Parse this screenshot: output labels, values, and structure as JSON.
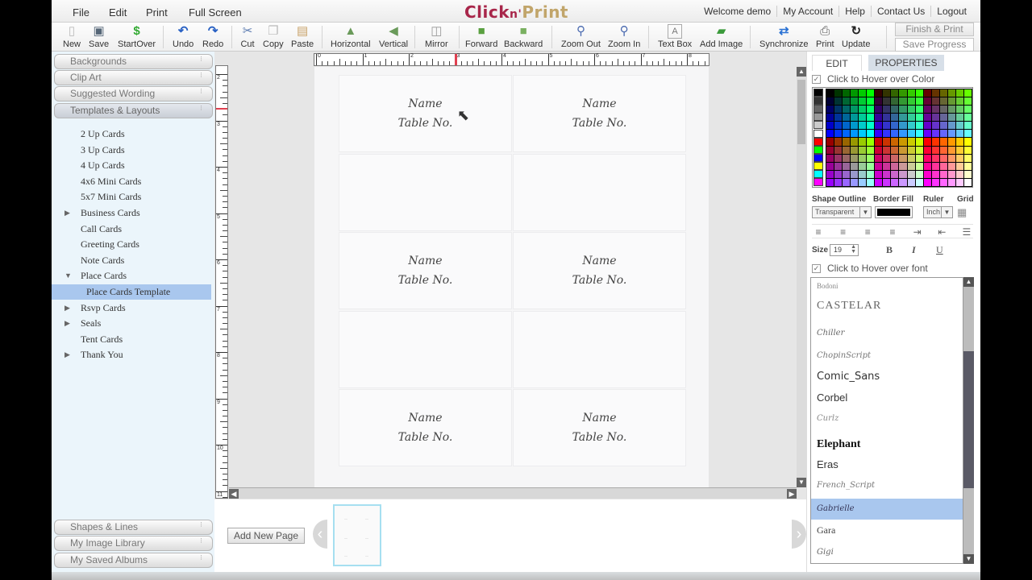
{
  "menubar": {
    "items": [
      "File",
      "Edit",
      "Print",
      "Full Screen"
    ],
    "logo": {
      "part1": "Click",
      "part2": "n'",
      "part3": "Print"
    },
    "user_links": [
      "Welcome demo",
      "My Account",
      "Help",
      "Contact Us",
      "Logout"
    ]
  },
  "toolbar": {
    "buttons": [
      {
        "label": "New",
        "icon": "new-document-icon"
      },
      {
        "label": "Save",
        "icon": "save-icon"
      },
      {
        "label": "StartOver",
        "icon": "start-over-icon"
      },
      {
        "label": "Undo",
        "icon": "undo-icon"
      },
      {
        "label": "Redo",
        "icon": "redo-icon"
      },
      {
        "label": "Cut",
        "icon": "scissors-icon"
      },
      {
        "label": "Copy",
        "icon": "copy-icon"
      },
      {
        "label": "Paste",
        "icon": "paste-icon"
      },
      {
        "label": "Horizontal",
        "icon": "flip-horizontal-icon"
      },
      {
        "label": "Vertical",
        "icon": "flip-vertical-icon"
      },
      {
        "label": "Mirror",
        "icon": "mirror-icon"
      },
      {
        "label": "Forward",
        "icon": "bring-forward-icon"
      },
      {
        "label": "Backward",
        "icon": "send-backward-icon"
      },
      {
        "label": "Zoom Out",
        "icon": "zoom-out-icon"
      },
      {
        "label": "Zoom In",
        "icon": "zoom-in-icon"
      },
      {
        "label": "Text Box",
        "icon": "text-box-icon"
      },
      {
        "label": "Add Image",
        "icon": "add-image-icon"
      },
      {
        "label": "Synchronize",
        "icon": "synchronize-icon"
      },
      {
        "label": "Print",
        "icon": "printer-icon"
      },
      {
        "label": "Update",
        "icon": "refresh-icon"
      }
    ],
    "finish_print": "Finish & Print",
    "save_progress": "Save Progress"
  },
  "left_panel": {
    "accordion_top": [
      "Backgrounds",
      "Clip Art",
      "Suggested Wording",
      "Templates & Layouts"
    ],
    "tree": [
      {
        "label": "2 Up Cards",
        "arrow": ""
      },
      {
        "label": "3 Up Cards",
        "arrow": ""
      },
      {
        "label": "4 Up Cards",
        "arrow": ""
      },
      {
        "label": "4x6 Mini Cards",
        "arrow": ""
      },
      {
        "label": "5x7 Mini Cards",
        "arrow": ""
      },
      {
        "label": "Business Cards",
        "arrow": "▶"
      },
      {
        "label": "Call Cards",
        "arrow": ""
      },
      {
        "label": "Greeting Cards",
        "arrow": ""
      },
      {
        "label": "Note Cards",
        "arrow": ""
      },
      {
        "label": "Place Cards",
        "arrow": "▼"
      },
      {
        "label": "Place Cards Template",
        "arrow": "",
        "selected": true,
        "child": true
      },
      {
        "label": "Rsvp Cards",
        "arrow": "▶"
      },
      {
        "label": "Seals",
        "arrow": "▶"
      },
      {
        "label": "Tent Cards",
        "arrow": ""
      },
      {
        "label": "Thank You",
        "arrow": "▶"
      }
    ],
    "accordion_bottom": [
      "Shapes & Lines",
      "My Image Library",
      "My Saved Albums"
    ]
  },
  "canvas": {
    "ruler_h_labels": [
      "0",
      "1",
      "2",
      "3",
      "4",
      "5",
      "6",
      "7",
      "8"
    ],
    "ruler_v_labels": [
      "2",
      "3",
      "4",
      "5",
      "6",
      "7",
      "8",
      "9",
      "10",
      "11"
    ],
    "cards": [
      {
        "name": "Name",
        "table": "Table No."
      },
      {
        "name": "Name",
        "table": "Table No."
      },
      {
        "name": "",
        "table": ""
      },
      {
        "name": "",
        "table": ""
      },
      {
        "name": "Name",
        "table": "Table No."
      },
      {
        "name": "Name",
        "table": "Table No."
      },
      {
        "name": "",
        "table": ""
      },
      {
        "name": "",
        "table": ""
      },
      {
        "name": "Name",
        "table": "Table No."
      },
      {
        "name": "Name",
        "table": "Table No."
      }
    ]
  },
  "page_strip": {
    "add_new_page": "Add New Page"
  },
  "right_panel": {
    "tabs": [
      "EDIT",
      "PROPERTIES"
    ],
    "active_tab": "EDIT",
    "hover_color_label": "Click to Hover over Color",
    "hover_color_checked": true,
    "labels": {
      "shape_outline": "Shape Outline",
      "border_fill": "Border Fill",
      "ruler": "Ruler",
      "grid": "Grid"
    },
    "shape_outline_value": "Transparent",
    "border_fill_color": "#000000",
    "ruler_value": "Inch",
    "size_label": "Size",
    "size_value": "19",
    "bold": "B",
    "italic": "I",
    "underline": "U",
    "hover_font_label": "Click to Hover over font",
    "hover_font_checked": true,
    "fonts": [
      "Bodoni",
      "CASTELAR",
      "Chiller",
      "ChopinScript",
      "Comic_Sans",
      "Corbel",
      "Curlz",
      "Elephant",
      "Eras",
      "French_Script",
      "Gabrielle",
      "Gara",
      "Gigi"
    ],
    "selected_font": "Gabrielle",
    "palette_swatches": [
      "#000000",
      "#333333",
      "#666666",
      "#999999",
      "#cccccc",
      "#ffffff",
      "#ff0000",
      "#00ff00",
      "#0000ff",
      "#ffff00",
      "#00ffff",
      "#ff00ff"
    ]
  }
}
